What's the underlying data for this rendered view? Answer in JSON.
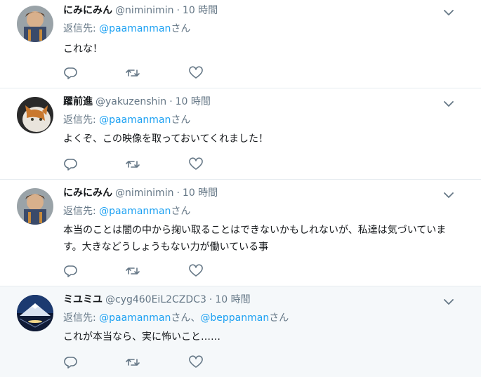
{
  "tweets": [
    {
      "name": "にみにみん",
      "handle": "@niminimin",
      "time": "10 時間",
      "reply_prefix": "返信先: ",
      "reply_to": "@paamanman",
      "reply_suffix": "さん",
      "reply_sep": "",
      "reply_to2": "",
      "reply_suffix2": "",
      "text": "これな！"
    },
    {
      "name": "躍前進",
      "handle": "@yakuzenshin",
      "time": "10 時間",
      "reply_prefix": "返信先: ",
      "reply_to": "@paamanman",
      "reply_suffix": "さん",
      "reply_sep": "",
      "reply_to2": "",
      "reply_suffix2": "",
      "text": "よくぞ、この映像を取っておいてくれました！"
    },
    {
      "name": "にみにみん",
      "handle": "@niminimin",
      "time": "10 時間",
      "reply_prefix": "返信先: ",
      "reply_to": "@paamanman",
      "reply_suffix": "さん",
      "reply_sep": "",
      "reply_to2": "",
      "reply_suffix2": "",
      "text": "本当のことは闇の中から掬い取ることはできないかもしれないが、私達は気づいています。大きなどうしょうもない力が働いている事"
    },
    {
      "name": "ミユミユ",
      "handle": "@cyg460EiL2CZDC3",
      "time": "10 時間",
      "reply_prefix": "返信先: ",
      "reply_to": "@paamanman",
      "reply_suffix": "さん",
      "reply_sep": "、",
      "reply_to2": "@beppanman",
      "reply_suffix2": "さん",
      "text": "これが本当なら、実に怖いこと……"
    }
  ],
  "header_dot": "·",
  "icons": {
    "reply": "reply-icon",
    "retweet": "retweet-icon",
    "like": "heart-icon",
    "caret": "chevron-down-icon"
  },
  "colors": {
    "link": "#1da1f2",
    "muted": "#657786",
    "divider": "#e6ecf0",
    "highlight_bg": "#f5f8fa"
  }
}
